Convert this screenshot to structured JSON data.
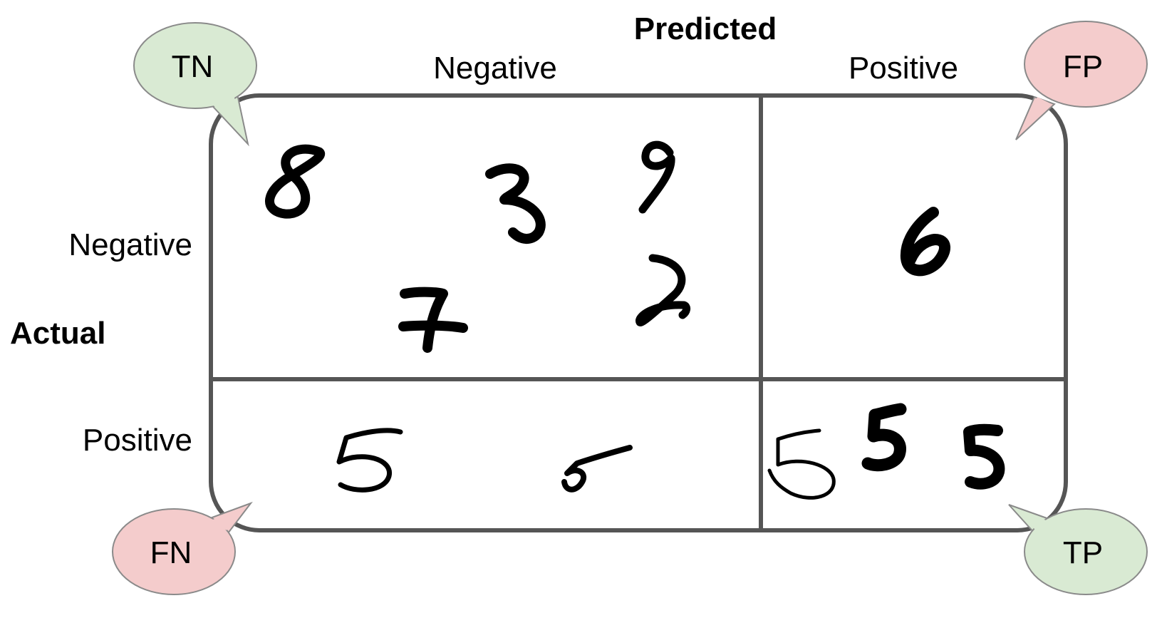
{
  "predicted_title": "Predicted",
  "actual_title": "Actual",
  "predicted_negative_label": "Negative",
  "predicted_positive_label": "Positive",
  "actual_negative_label": "Negative",
  "actual_positive_label": "Positive",
  "quadrants": {
    "tn": {
      "label": "TN",
      "color": "#d9ead3",
      "digits": [
        "8",
        "3",
        "9",
        "7",
        "2"
      ]
    },
    "fp": {
      "label": "FP",
      "color": "#f4cccc",
      "digits": [
        "6"
      ]
    },
    "fn": {
      "label": "FN",
      "color": "#f4cccc",
      "digits": [
        "5",
        "5"
      ]
    },
    "tp": {
      "label": "TP",
      "color": "#d9ead3",
      "digits": [
        "5",
        "5",
        "5"
      ]
    }
  }
}
